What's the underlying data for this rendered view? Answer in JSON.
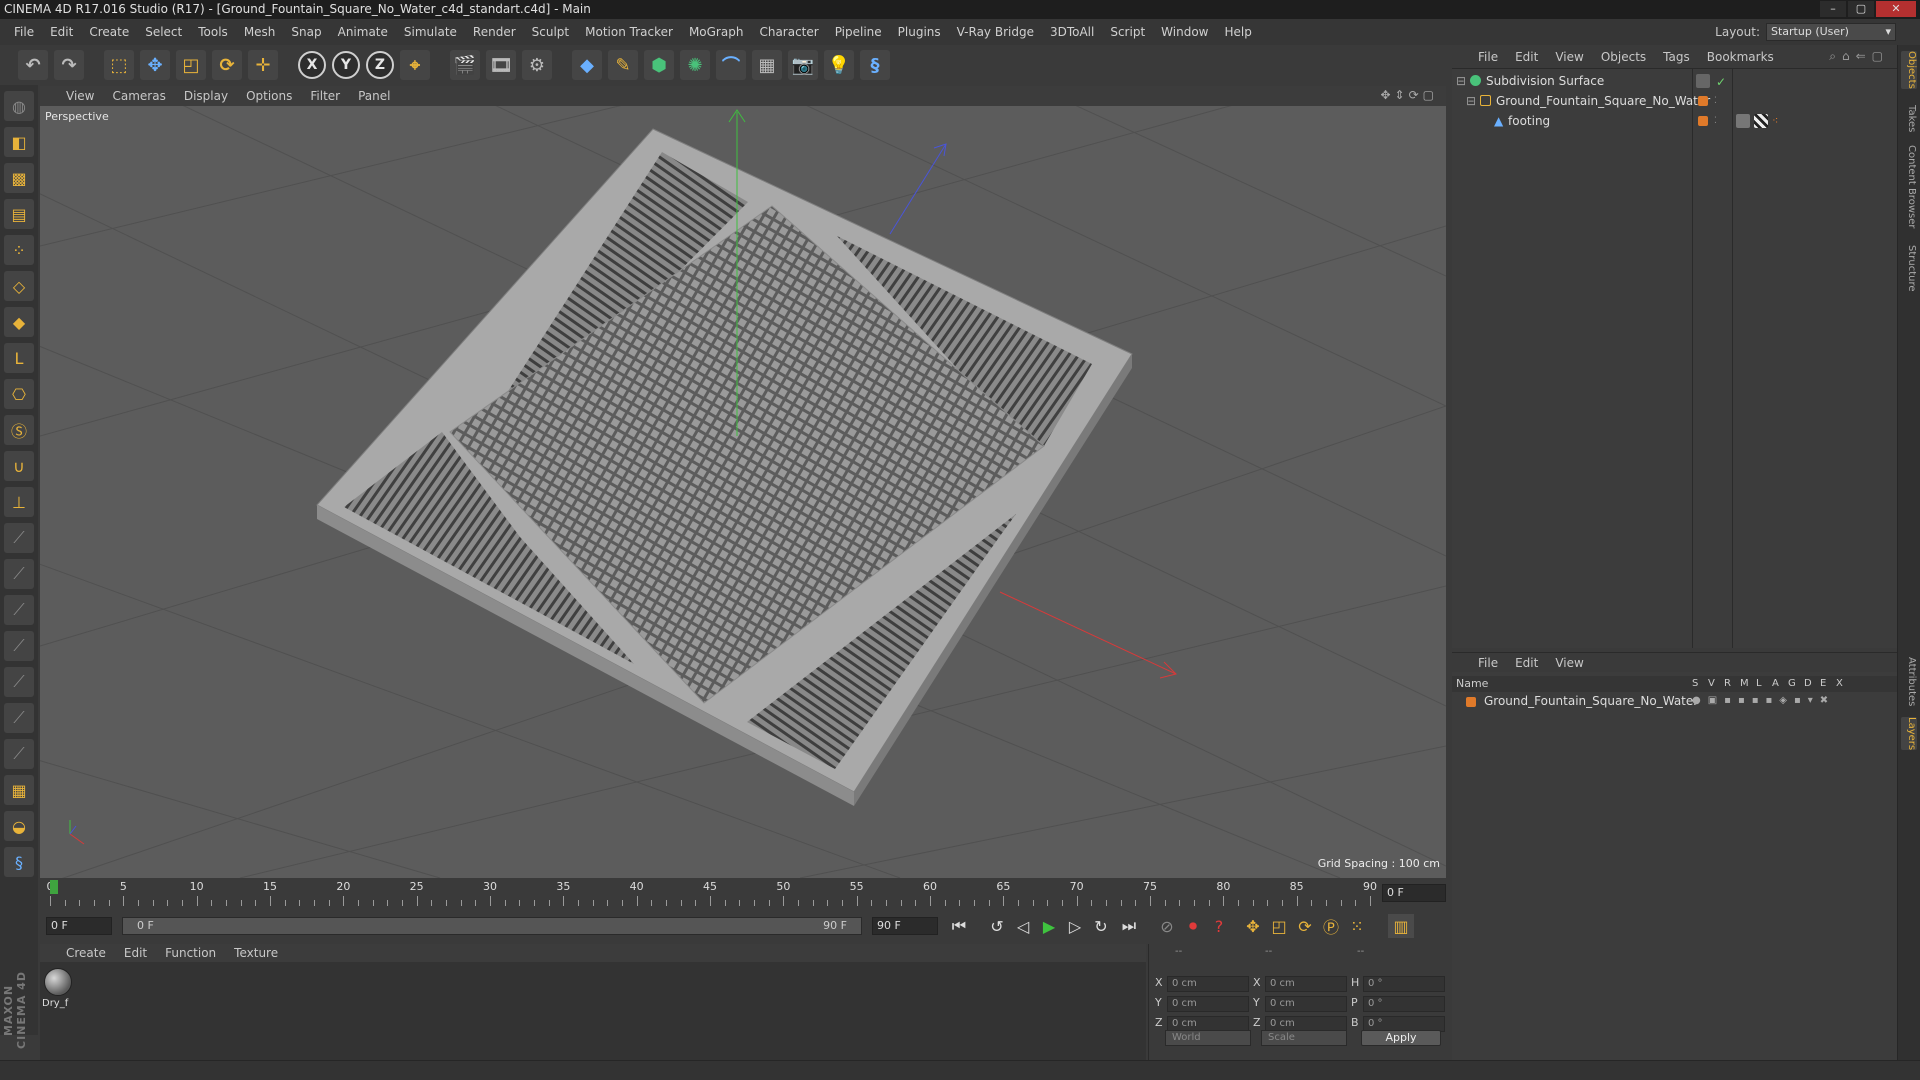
{
  "window": {
    "title": "CINEMA 4D R17.016 Studio (R17) - [Ground_Fountain_Square_No_Water_c4d_standart.c4d] - Main",
    "buttons": [
      "–",
      "▢",
      "✕"
    ]
  },
  "menubar": {
    "items": [
      "File",
      "Edit",
      "Create",
      "Select",
      "Tools",
      "Mesh",
      "Snap",
      "Animate",
      "Simulate",
      "Render",
      "Sculpt",
      "Motion Tracker",
      "MoGraph",
      "Character",
      "Pipeline",
      "Plugins",
      "V-Ray Bridge",
      "3DToAll",
      "Script",
      "Window",
      "Help"
    ],
    "layout_label": "Layout:",
    "layout_value": "Startup (User)"
  },
  "toolbar": {
    "axis_x": "X",
    "axis_y": "Y",
    "axis_z": "Z"
  },
  "viewport": {
    "menu": [
      "View",
      "Cameras",
      "Display",
      "Options",
      "Filter",
      "Panel"
    ],
    "label": "Perspective",
    "grid_spacing": "Grid Spacing : 100 cm"
  },
  "timeline": {
    "ticks": [
      "0",
      "5",
      "10",
      "15",
      "20",
      "25",
      "30",
      "35",
      "40",
      "45",
      "50",
      "55",
      "60",
      "65",
      "70",
      "75",
      "80",
      "85",
      "90"
    ],
    "current_frame": "0 F"
  },
  "transport": {
    "start_field": "0 F",
    "range_start": "0 F",
    "range_end": "90 F",
    "end_field": "90 F"
  },
  "materials": {
    "menu": [
      "Create",
      "Edit",
      "Function",
      "Texture"
    ],
    "items": [
      {
        "name": "Dry_f"
      }
    ]
  },
  "coordinates": {
    "headers": [
      "--",
      "--",
      "--"
    ],
    "rows": [
      {
        "l1": "X",
        "v1": "0 cm",
        "l2": "X",
        "v2": "0 cm",
        "l3": "H",
        "v3": "0 °"
      },
      {
        "l1": "Y",
        "v1": "0 cm",
        "l2": "Y",
        "v2": "0 cm",
        "l3": "P",
        "v3": "0 °"
      },
      {
        "l1": "Z",
        "v1": "0 cm",
        "l2": "Z",
        "v2": "0 cm",
        "l3": "B",
        "v3": "0 °"
      }
    ],
    "world": "World",
    "scale": "Scale",
    "apply": "Apply"
  },
  "object_manager": {
    "menu": [
      "File",
      "Edit",
      "View",
      "Objects",
      "Tags",
      "Bookmarks"
    ],
    "objects": [
      {
        "name": "Subdivision Surface"
      },
      {
        "name": "Ground_Fountain_Square_No_Water"
      },
      {
        "name": "footing"
      }
    ]
  },
  "layer_manager": {
    "menu": [
      "File",
      "Edit",
      "View"
    ],
    "columns": [
      "Name",
      "S",
      "V",
      "R",
      "M",
      "L",
      "A",
      "G",
      "D",
      "E",
      "X"
    ],
    "layers": [
      {
        "name": "Ground_Fountain_Square_No_Water"
      }
    ]
  },
  "side_tabs": [
    "Objects",
    "Takes",
    "Content Browser",
    "Structure",
    "Attributes",
    "Layers"
  ],
  "branding": "MAXON CINEMA 4D",
  "colors": {
    "accent": "#e8b33a",
    "layer_color": "#e07a2a",
    "play": "#3fc33f",
    "record": "#e03a3a"
  }
}
